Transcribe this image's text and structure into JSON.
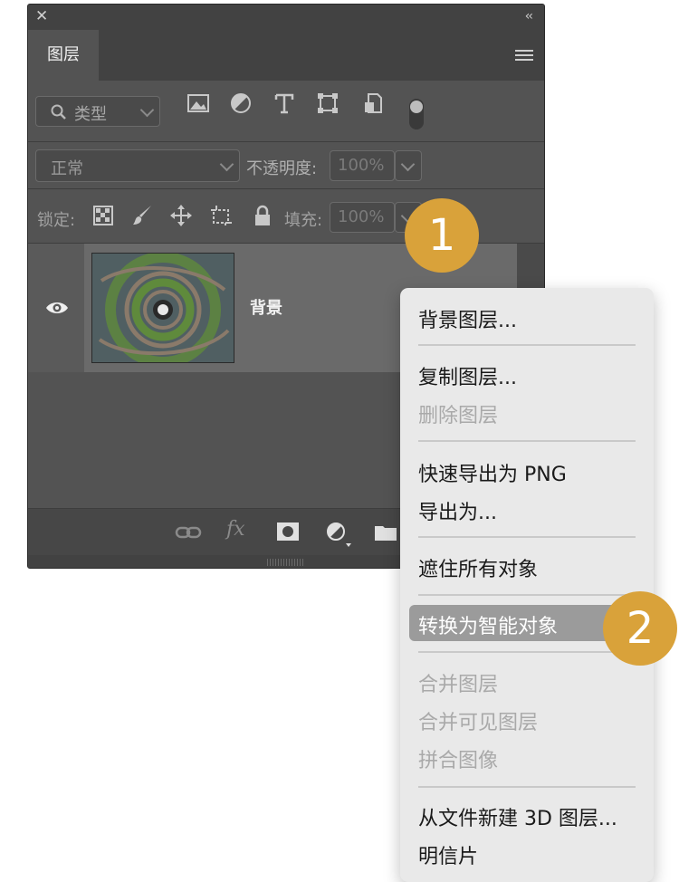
{
  "panel": {
    "tab_label": "图层",
    "filter": {
      "type_label": "类型"
    },
    "blend": {
      "mode": "正常",
      "opacity_label": "不透明度:",
      "opacity_value": "100%"
    },
    "lock": {
      "label": "锁定:",
      "fill_label": "填充:",
      "fill_value": "100%"
    },
    "layer": {
      "name": "背景"
    },
    "bottom": {
      "fx_label": "fx"
    }
  },
  "badges": {
    "one": "1",
    "two": "2"
  },
  "context_menu": {
    "items": [
      {
        "label": "背景图层...",
        "enabled": true
      },
      {
        "label": "复制图层...",
        "enabled": true
      },
      {
        "label": "删除图层",
        "enabled": false
      },
      {
        "label": "快速导出为 PNG",
        "enabled": true
      },
      {
        "label": "导出为...",
        "enabled": true
      },
      {
        "label": "遮住所有对象",
        "enabled": true
      },
      {
        "label": "转换为智能对象",
        "enabled": true,
        "highlighted": true
      },
      {
        "label": "合并图层",
        "enabled": false
      },
      {
        "label": "合并可见图层",
        "enabled": false
      },
      {
        "label": "拼合图像",
        "enabled": false
      },
      {
        "label": "从文件新建 3D 图层...",
        "enabled": true
      },
      {
        "label": "明信片",
        "enabled": true
      }
    ]
  },
  "colors": {
    "panel_bg": "#535353",
    "badge": "#d9a23a",
    "menu_bg": "#e9e9e9",
    "highlight": "#9b9b9b"
  },
  "icons": [
    "close-icon",
    "collapse-icon",
    "panel-menu-icon",
    "search-icon",
    "image-filter-icon",
    "adjustment-filter-icon",
    "type-filter-icon",
    "shape-filter-icon",
    "smart-object-filter-icon",
    "filter-toggle-icon",
    "lock-transparent-icon",
    "lock-brush-icon",
    "lock-move-icon",
    "lock-artboard-icon",
    "lock-all-icon",
    "eye-icon",
    "link-icon",
    "fx-icon",
    "mask-icon",
    "adjustment-icon",
    "folder-icon"
  ]
}
